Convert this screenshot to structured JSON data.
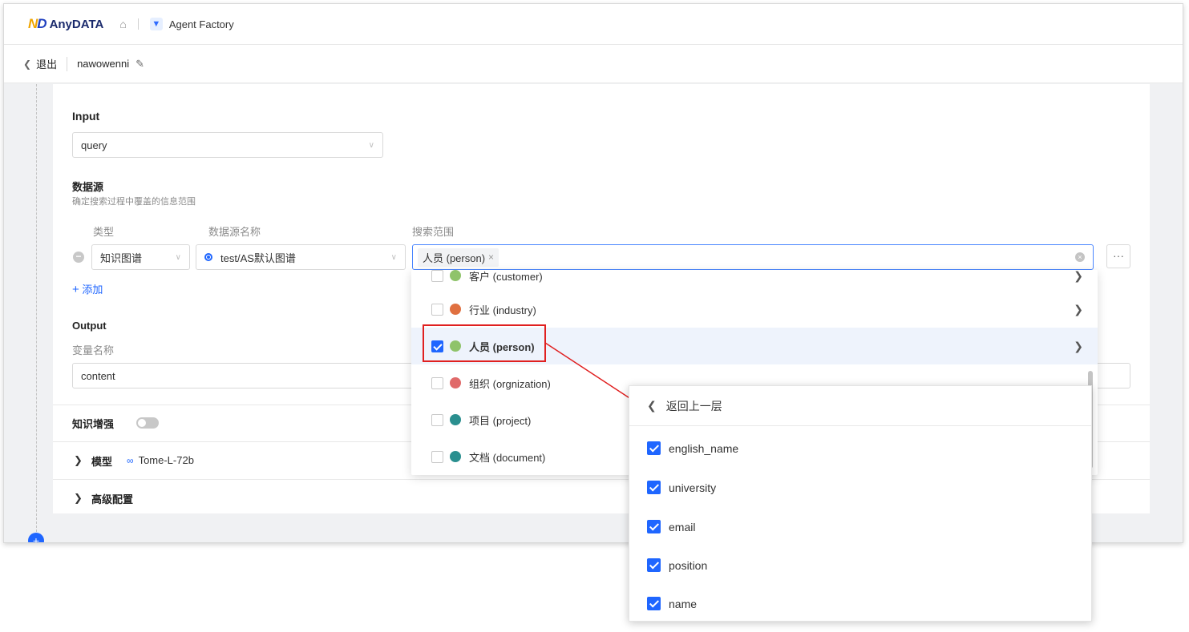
{
  "header": {
    "logo_mark": "ND",
    "logo_text": "AnyDATA",
    "app_name": "Agent Factory"
  },
  "subheader": {
    "back_label": "退出",
    "agent_name": "nawowenni"
  },
  "form": {
    "input_label": "Input",
    "input_value": "query",
    "datasource_title": "数据源",
    "datasource_hint": "确定搜索过程中覆盖的信息范围",
    "col_type": "类型",
    "col_name": "数据源名称",
    "col_scope": "搜索范围",
    "row_type": "知识图谱",
    "row_name": "test/AS默认图谱",
    "row_scope_tag": "人员 (person)",
    "more_label": "···",
    "add_label": "添加",
    "output_label": "Output",
    "var_label": "变量名称",
    "var_value": "content",
    "knowledge_label": "知识增强",
    "model_label": "模型",
    "model_value": "Tome-L-72b",
    "advanced_label": "高级配置"
  },
  "entity_dropdown": {
    "items": [
      {
        "label": "客户 (customer)",
        "color": "#8fc36a",
        "checked": false
      },
      {
        "label": "行业 (industry)",
        "color": "#e07040",
        "checked": false
      },
      {
        "label": "人员 (person)",
        "color": "#8fc36a",
        "checked": true
      },
      {
        "label": "组织 (orgnization)",
        "color": "#e06a6a",
        "checked": false
      },
      {
        "label": "项目 (project)",
        "color": "#2a8f8f",
        "checked": false
      },
      {
        "label": "文档 (document)",
        "color": "#2a8f8f",
        "checked": false
      }
    ]
  },
  "attribute_popup": {
    "back_label": "返回上一层",
    "items": [
      {
        "label": "english_name",
        "checked": true
      },
      {
        "label": "university",
        "checked": true
      },
      {
        "label": "email",
        "checked": true
      },
      {
        "label": "position",
        "checked": true
      },
      {
        "label": "name",
        "checked": true
      }
    ]
  },
  "colors": {
    "accent": "#1f66ff",
    "annotation": "#e02020"
  }
}
